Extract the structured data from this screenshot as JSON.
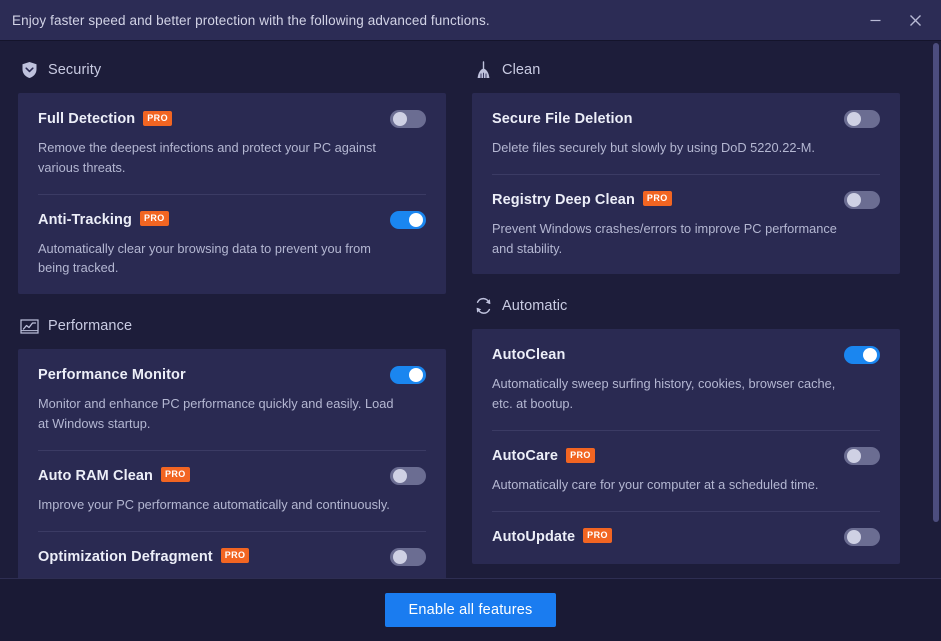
{
  "titlebar": {
    "text": "Enjoy faster speed and better protection with the following advanced functions.",
    "minimize_label": "Minimize",
    "close_label": "Close"
  },
  "colors": {
    "page_bg": "#1d1d3a",
    "titlebar_bg": "#2c2c55",
    "card_bg": "#2a2a52",
    "accent_blue": "#1a7cf0",
    "toggle_on": "#1a86f0",
    "toggle_off": "#6b6d92",
    "pro_badge": "#f26522",
    "footer_bg": "#1a1a35"
  },
  "pro_badge_label": "PRO",
  "groups": [
    {
      "id": "security",
      "title": "Security",
      "icon": "shield-icon",
      "column": "left",
      "features": [
        {
          "name": "Full Detection",
          "pro": true,
          "description": "Remove the deepest infections and protect your PC against various threats.",
          "toggle": "off"
        },
        {
          "name": "Anti-Tracking",
          "pro": true,
          "description": "Automatically clear your browsing data to prevent you from being tracked.",
          "toggle": "on"
        }
      ]
    },
    {
      "id": "clean",
      "title": "Clean",
      "icon": "broom-icon",
      "column": "right",
      "features": [
        {
          "name": "Secure File Deletion",
          "pro": false,
          "description": "Delete files securely but slowly by using DoD 5220.22-M.",
          "toggle": "off"
        },
        {
          "name": "Registry Deep Clean",
          "pro": true,
          "description": "Prevent Windows crashes/errors to improve PC performance and stability.",
          "toggle": "off"
        }
      ]
    },
    {
      "id": "performance",
      "title": "Performance",
      "icon": "chart-icon",
      "column": "left",
      "features": [
        {
          "name": "Performance Monitor",
          "pro": false,
          "description": "Monitor and enhance PC performance quickly and easily. Load at Windows startup.",
          "toggle": "on"
        },
        {
          "name": "Auto RAM Clean",
          "pro": true,
          "description": "Improve your PC performance automatically and continuously.",
          "toggle": "off"
        },
        {
          "name": "Optimization Defragment",
          "pro": true,
          "description": "",
          "toggle": "off"
        }
      ]
    },
    {
      "id": "automatic",
      "title": "Automatic",
      "icon": "refresh-icon",
      "column": "right",
      "features": [
        {
          "name": "AutoClean",
          "pro": false,
          "description": "Automatically sweep surfing history, cookies, browser cache, etc. at bootup.",
          "toggle": "on"
        },
        {
          "name": "AutoCare",
          "pro": true,
          "description": "Automatically care for your computer at a scheduled time.",
          "toggle": "off"
        },
        {
          "name": "AutoUpdate",
          "pro": true,
          "description": "",
          "toggle": "off"
        }
      ]
    }
  ],
  "footer": {
    "button_label": "Enable all features"
  }
}
